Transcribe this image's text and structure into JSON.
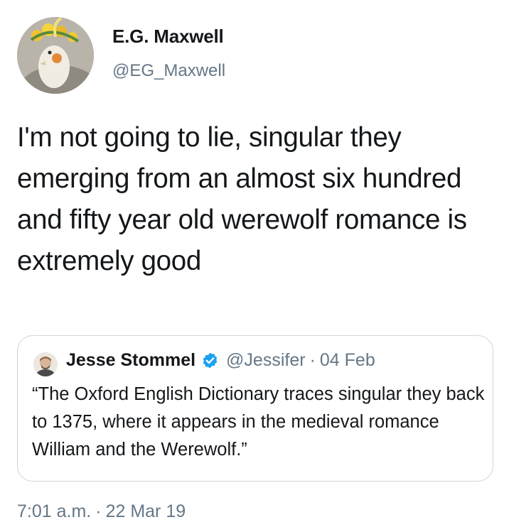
{
  "author": {
    "name": "E.G. Maxwell",
    "handle": "@EG_Maxwell",
    "avatar_icon": "cockatiel-avatar-icon"
  },
  "tweet": {
    "text": "I'm not going to lie, singular they emerging from an almost six hundred and fifty year old werewolf romance is extremely good"
  },
  "quote": {
    "author_name": "Jesse Stommel",
    "verified_icon": "verified-badge-icon",
    "handle": "@Jessifer",
    "separator": "·",
    "date": "04 Feb",
    "text": "“The Oxford English Dictionary traces singular they back to 1375, where it appears in the medieval romance William and the Werewolf.”"
  },
  "meta": {
    "time": "7:01 a.m.",
    "separator": "·",
    "date": "22 Mar 19"
  },
  "colors": {
    "primary_text": "#14171a",
    "secondary_text": "#657786",
    "border": "#ccd6dd",
    "verified_blue": "#1da1f2"
  }
}
